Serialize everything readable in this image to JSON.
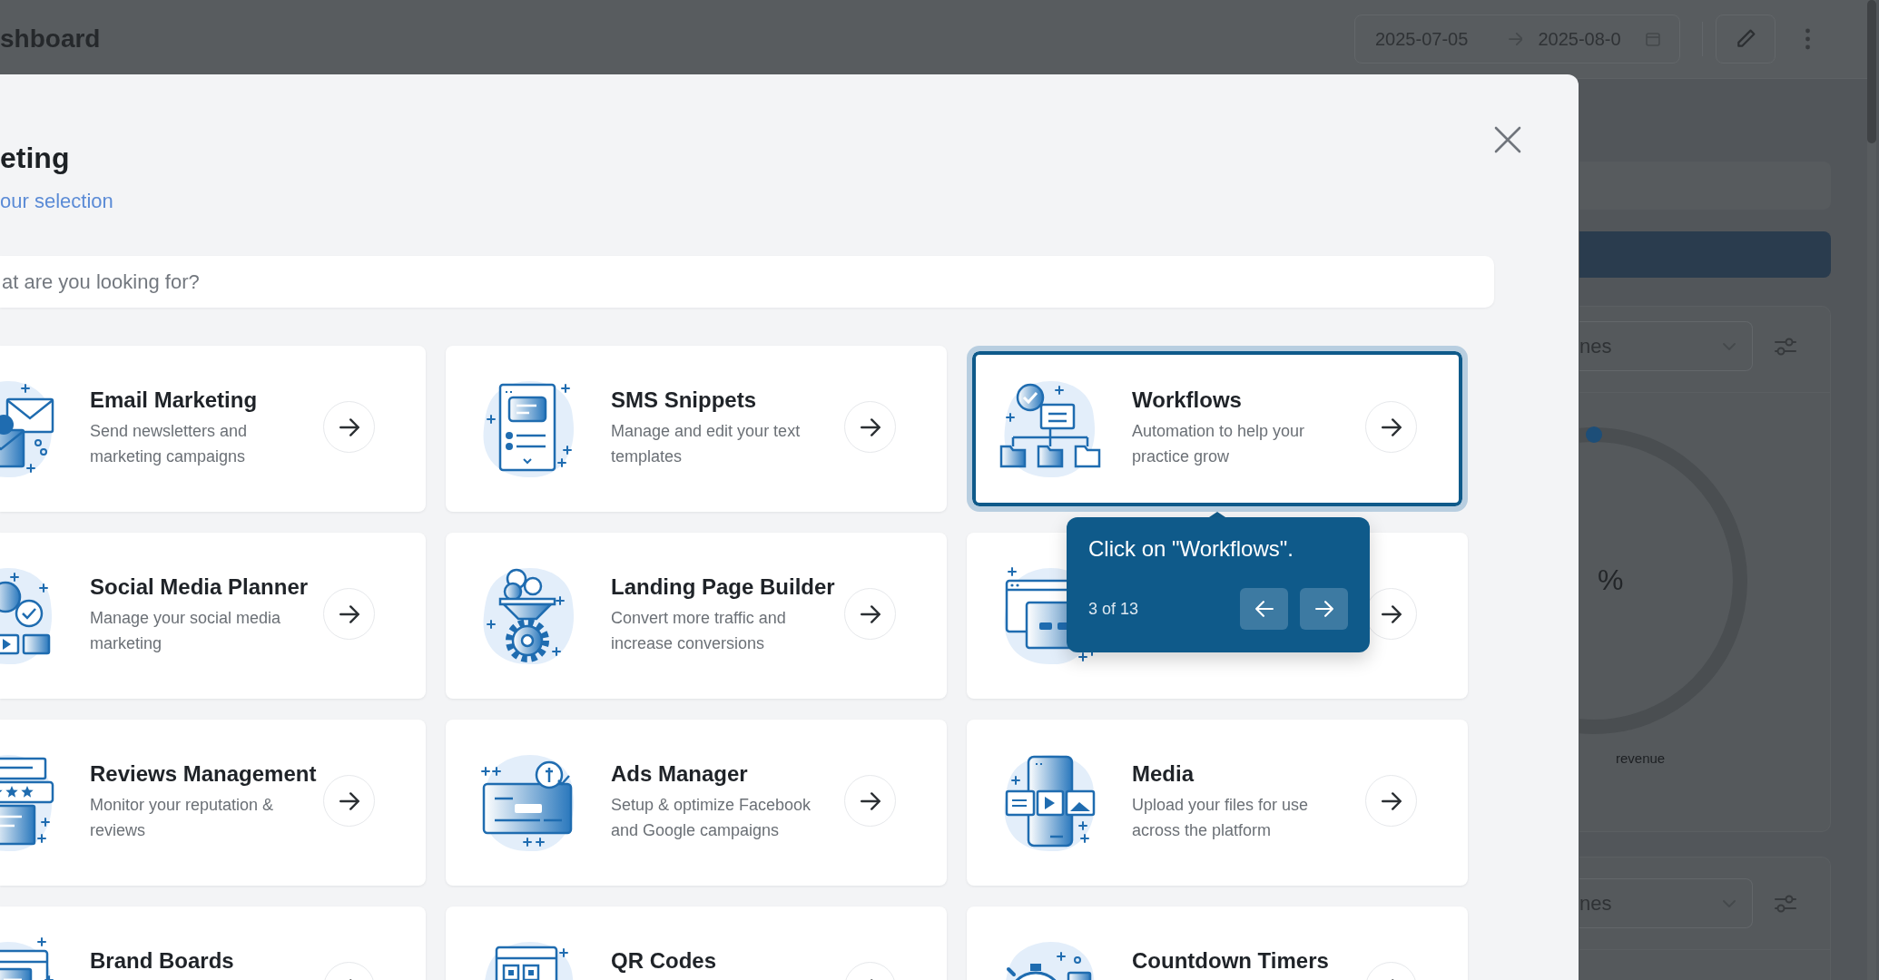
{
  "page": {
    "title": "shboard",
    "date_start": "2025-07-05",
    "date_end": "2025-08-0",
    "panels": [
      {
        "dropdown": "nes",
        "gauge": {
          "value": "%",
          "level": 0,
          "caption": "revenue"
        }
      },
      {
        "dropdown": "nes"
      }
    ]
  },
  "modal": {
    "title": "eting",
    "link": "our selection",
    "search": {
      "placeholder": "at are you looking for?"
    },
    "cards": [
      {
        "title": "Email Marketing",
        "description": "Send newsletters and marketing campaigns",
        "highlighted": false
      },
      {
        "title": "SMS Snippets",
        "description": "Manage and edit your text templates",
        "highlighted": false
      },
      {
        "title": "Workflows",
        "description": "Automation to help your practice grow",
        "highlighted": true
      },
      {
        "title": "Social Media Planner",
        "description": "Manage your social media marketing",
        "highlighted": false
      },
      {
        "title": "Landing Page Builder",
        "description": "Convert more traffic and increase conversions",
        "highlighted": false
      },
      {
        "highlighted": false
      },
      {
        "title": "Reviews Management",
        "description": "Monitor your reputation & reviews",
        "highlighted": false
      },
      {
        "title": "Ads Manager",
        "description": "Setup & optimize Facebook and Google campaigns",
        "highlighted": false
      },
      {
        "title": "Media",
        "description": "Upload your files for use across the platform",
        "highlighted": false
      },
      {
        "title": "Brand Boards",
        "highlighted": false
      },
      {
        "title": "QR Codes",
        "highlighted": false
      },
      {
        "title": "Countdown Timers",
        "highlighted": false
      }
    ]
  },
  "tour": {
    "message": "Click on \"Workflows\".",
    "step": "3 of 13"
  }
}
